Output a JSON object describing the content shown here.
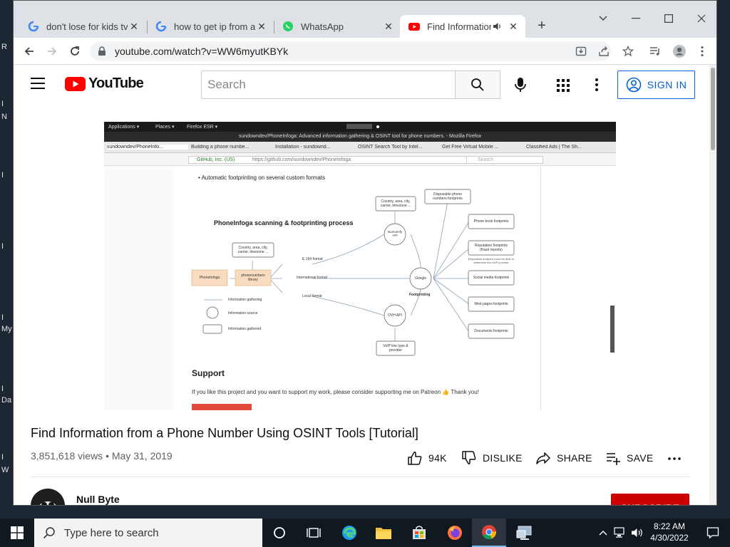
{
  "desktop": {
    "icon_labels": [
      "R",
      "I",
      "N",
      "I",
      "I",
      "I",
      "My",
      "I",
      "Da",
      "I",
      "W"
    ]
  },
  "browser": {
    "tabs": [
      {
        "title": "don't lose for kids tv",
        "icon": "google-icon"
      },
      {
        "title": "how to get ip from an",
        "icon": "google-icon"
      },
      {
        "title": "WhatsApp",
        "icon": "whatsapp-icon"
      },
      {
        "title": "Find Information",
        "icon": "youtube-icon",
        "active": true,
        "audio": true
      }
    ],
    "new_tab_label": "+",
    "address": "youtube.com/watch?v=WW6myutKBYk"
  },
  "youtube": {
    "logo_text": "YouTube",
    "search_placeholder": "Search",
    "sign_in_label": "SIGN IN",
    "video": {
      "title": "Find Information from a Phone Number Using OSINT Tools [Tutorial]",
      "views": "3,851,618 views",
      "separator": "•",
      "date": "May 31, 2019",
      "likes": "94K",
      "dislike_label": "DISLIKE",
      "share_label": "SHARE",
      "save_label": "SAVE"
    },
    "channel": {
      "name": "Null Byte",
      "subscribe_label": "SUBSCRIBE"
    },
    "frame": {
      "menu": [
        "Applications ▾",
        "Places ▾",
        "Firefox ESR ▾"
      ],
      "window_title": "sundowndev/PhoneInfoga: Advanced information gathering & OSINT tool for phone numbers. - Mozilla Firefox",
      "tabs": [
        "sundowndev/PhoneInfo...",
        "Building a phone numbe...",
        "Installation - sundownd...",
        "OSINT Search Tool by Intel...",
        "Get Free Virtual Mobile ...",
        "Classified Ads | The Sh..."
      ],
      "site_badge": "GitHub, Inc. (US)",
      "url": "https://github.com/sundowndev/PhoneInfoga",
      "search_placeholder": "Search",
      "bullet": "Automatic footprinting on several custom formats",
      "diagram": {
        "title": "PhoneInfoga scanning & footprinting process",
        "phoneinfoga": "PhoneInfoga",
        "phonenumber": "phonenumbers library",
        "country_left": "Country, area, city, carrier, timezone ...",
        "country_top": "Country, area, city, carrier, timezone ...",
        "disposable": "Disposable phone numbers footprints",
        "e164": "E.164 format",
        "intl": "International format",
        "local": "Local format",
        "numverify": "Numverify API",
        "ovh": "OVH API",
        "voip": "VoIP line type & provider",
        "google": "Google",
        "footprinting": "Footprinting",
        "phonebook": "Phone book footprints",
        "reputation": "Reputation footprints (fraud reports)",
        "reputation_note": "Reputation footprint could be able to determine the VoIP provider",
        "social": "Social media footprints",
        "webpages": "Web pages footprints",
        "documents": "Documents footprints",
        "legend": [
          "Information gathering",
          "Information source",
          "Information gathered"
        ]
      },
      "support_heading": "Support",
      "support_text": "If you like this project and you want to support my work, please consider supporting me on Patreon 👍 Thank you!"
    }
  },
  "taskbar": {
    "search_placeholder": "Type here to search",
    "time": "8:22 AM",
    "date": "4/30/2022"
  }
}
